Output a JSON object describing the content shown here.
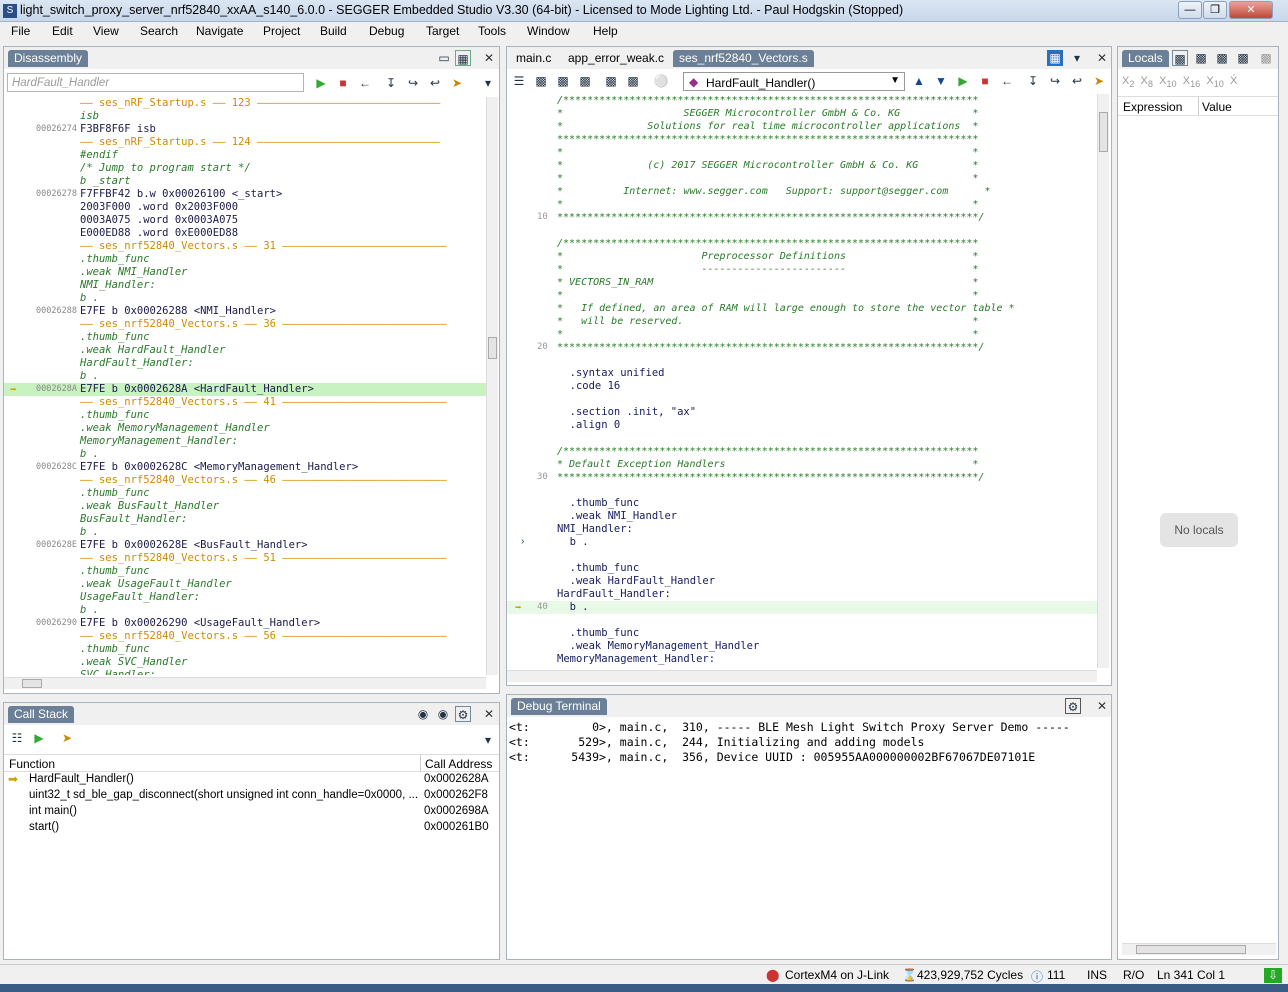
{
  "window": {
    "title": "light_switch_proxy_server_nrf52840_xxAA_s140_6.0.0 - SEGGER Embedded Studio V3.30 (64-bit) - Licensed to Mode Lighting Ltd. - Paul Hodgskin (Stopped)"
  },
  "menu": [
    "File",
    "Edit",
    "View",
    "Search",
    "Navigate",
    "Project",
    "Build",
    "Debug",
    "Target",
    "Tools",
    "Window",
    "Help"
  ],
  "disassembly": {
    "tab": "Disassembly",
    "search_placeholder": "HardFault_Handler",
    "lines": [
      {
        "t": "src",
        "text": "—— ses_nRF_Startup.s —— 123 —————————————————————————————"
      },
      {
        "t": "src-code",
        "text": "isb"
      },
      {
        "t": "ins",
        "addr": "00026274",
        "text": "    F3BF8F6F    isb"
      },
      {
        "t": "src",
        "text": "—— ses_nRF_Startup.s —— 124 —————————————————————————————"
      },
      {
        "t": "src-code",
        "text": "#endif"
      },
      {
        "t": "src-code",
        "text": "/* Jump to program start */"
      },
      {
        "t": "src-code",
        "text": "b _start"
      },
      {
        "t": "ins",
        "addr": "00026278",
        "text": "    F7FFBF42    b.w 0x00026100 <_start>"
      },
      {
        "t": "ins",
        "addr": "",
        "text": "    2003F000    .word 0x2003F000"
      },
      {
        "t": "ins",
        "addr": "",
        "text": "    0003A075    .word 0x0003A075"
      },
      {
        "t": "ins",
        "addr": "",
        "text": "    E000ED88    .word 0xE000ED88"
      },
      {
        "t": "src",
        "text": "—— ses_nrf52840_Vectors.s —— 31 ——————————————————————————"
      },
      {
        "t": "src-code",
        "text": ".thumb_func"
      },
      {
        "t": "src-code",
        "text": ".weak NMI_Handler"
      },
      {
        "t": "src-code",
        "text": "NMI_Handler:"
      },
      {
        "t": "src-code",
        "text": "b ."
      },
      {
        "t": "ins",
        "addr": "00026288",
        "text": "      E7FE        b 0x00026288 <NMI_Handler>"
      },
      {
        "t": "src",
        "text": "—— ses_nrf52840_Vectors.s —— 36 ——————————————————————————"
      },
      {
        "t": "src-code",
        "text": ".thumb_func"
      },
      {
        "t": "src-code",
        "text": ".weak HardFault_Handler"
      },
      {
        "t": "src-code",
        "text": "HardFault_Handler:"
      },
      {
        "t": "src-code",
        "text": "b ."
      },
      {
        "t": "cur",
        "addr": "0002628A",
        "text": "      E7FE        b 0x0002628A <HardFault_Handler>"
      },
      {
        "t": "src",
        "text": "—— ses_nrf52840_Vectors.s —— 41 ——————————————————————————"
      },
      {
        "t": "src-code",
        "text": ".thumb_func"
      },
      {
        "t": "src-code",
        "text": ".weak MemoryManagement_Handler"
      },
      {
        "t": "src-code",
        "text": "MemoryManagement_Handler:"
      },
      {
        "t": "src-code",
        "text": "b ."
      },
      {
        "t": "ins",
        "addr": "0002628C",
        "text": "      E7FE        b 0x0002628C <MemoryManagement_Handler>"
      },
      {
        "t": "src",
        "text": "—— ses_nrf52840_Vectors.s —— 46 ——————————————————————————"
      },
      {
        "t": "src-code",
        "text": ".thumb_func"
      },
      {
        "t": "src-code",
        "text": ".weak BusFault_Handler"
      },
      {
        "t": "src-code",
        "text": "BusFault_Handler:"
      },
      {
        "t": "src-code",
        "text": "b ."
      },
      {
        "t": "ins",
        "addr": "0002628E",
        "text": "      E7FE        b 0x0002628E <BusFault_Handler>"
      },
      {
        "t": "src",
        "text": "—— ses_nrf52840_Vectors.s —— 51 ——————————————————————————"
      },
      {
        "t": "src-code",
        "text": ".thumb_func"
      },
      {
        "t": "src-code",
        "text": ".weak UsageFault_Handler"
      },
      {
        "t": "src-code",
        "text": "UsageFault_Handler:"
      },
      {
        "t": "src-code",
        "text": "b ."
      },
      {
        "t": "ins",
        "addr": "00026290",
        "text": "      E7FE        b 0x00026290 <UsageFault_Handler>"
      },
      {
        "t": "src",
        "text": "—— ses_nrf52840_Vectors.s —— 56 ——————————————————————————"
      },
      {
        "t": "src-code",
        "text": ".thumb_func"
      },
      {
        "t": "src-code",
        "text": ".weak SVC_Handler"
      },
      {
        "t": "src-code",
        "text": "SVC_Handler:"
      }
    ]
  },
  "editor": {
    "tabs": [
      "main.c",
      "app_error_weak.c",
      "ses_nrf52840_Vectors.s"
    ],
    "function_select": "HardFault_Handler()",
    "lines": [
      {
        "n": "",
        "c": "cmt",
        "text": "/*********************************************************************"
      },
      {
        "n": "",
        "c": "cmt",
        "text": "*                    SEGGER Microcontroller GmbH & Co. KG            *"
      },
      {
        "n": "",
        "c": "cmt",
        "text": "*              Solutions for real time microcontroller applications  *"
      },
      {
        "n": "",
        "c": "cmt",
        "text": "**********************************************************************"
      },
      {
        "n": "",
        "c": "cmt",
        "text": "*                                                                    *"
      },
      {
        "n": "",
        "c": "cmt",
        "text": "*              (c) 2017 SEGGER Microcontroller GmbH & Co. KG         *"
      },
      {
        "n": "",
        "c": "cmt",
        "text": "*                                                                    *"
      },
      {
        "n": "",
        "c": "cmt",
        "text": "*          Internet: www.segger.com   Support: support@segger.com      *"
      },
      {
        "n": "",
        "c": "cmt",
        "text": "*                                                                    *"
      },
      {
        "n": "10",
        "c": "cmt",
        "text": "**********************************************************************/"
      },
      {
        "n": "",
        "c": "",
        "text": ""
      },
      {
        "n": "",
        "c": "cmt",
        "text": "/*********************************************************************"
      },
      {
        "n": "",
        "c": "cmt",
        "text": "*                       Preprocessor Definitions                     *"
      },
      {
        "n": "",
        "c": "cmt",
        "text": "*                       ------------------------                     *"
      },
      {
        "n": "",
        "c": "cmt",
        "text": "* VECTORS_IN_RAM                                                     *"
      },
      {
        "n": "",
        "c": "cmt",
        "text": "*                                                                    *"
      },
      {
        "n": "",
        "c": "cmt",
        "text": "*   If defined, an area of RAM will large enough to store the vector table *"
      },
      {
        "n": "",
        "c": "cmt",
        "text": "*   will be reserved.                                                *"
      },
      {
        "n": "",
        "c": "cmt",
        "text": "*                                                                    *"
      },
      {
        "n": "20",
        "c": "cmt",
        "text": "**********************************************************************/"
      },
      {
        "n": "",
        "c": "",
        "text": ""
      },
      {
        "n": "",
        "c": "code",
        "text": "  .syntax unified"
      },
      {
        "n": "",
        "c": "code",
        "text": "  .code 16"
      },
      {
        "n": "",
        "c": "",
        "text": ""
      },
      {
        "n": "",
        "c": "code",
        "text": "  .section .init, \"ax\""
      },
      {
        "n": "",
        "c": "code",
        "text": "  .align 0"
      },
      {
        "n": "",
        "c": "",
        "text": ""
      },
      {
        "n": "",
        "c": "cmt",
        "text": "/*********************************************************************"
      },
      {
        "n": "",
        "c": "cmt",
        "text": "* Default Exception Handlers                                         *"
      },
      {
        "n": "30",
        "c": "cmt",
        "text": "**********************************************************************/"
      },
      {
        "n": "",
        "c": "",
        "text": ""
      },
      {
        "n": "",
        "c": "code",
        "text": "  .thumb_func"
      },
      {
        "n": "",
        "c": "code",
        "text": "  .weak NMI_Handler"
      },
      {
        "n": "",
        "c": "code",
        "text": "NMI_Handler:"
      },
      {
        "n": "",
        "c": "code",
        "text": "  b ."
      },
      {
        "n": "",
        "c": "",
        "text": ""
      },
      {
        "n": "",
        "c": "code",
        "text": "  .thumb_func"
      },
      {
        "n": "",
        "c": "code",
        "text": "  .weak HardFault_Handler"
      },
      {
        "n": "",
        "c": "code",
        "text": "HardFault_Handler:"
      },
      {
        "n": "40",
        "c": "cur",
        "text": "  b ."
      },
      {
        "n": "",
        "c": "",
        "text": ""
      },
      {
        "n": "",
        "c": "code",
        "text": "  .thumb_func"
      },
      {
        "n": "",
        "c": "code",
        "text": "  .weak MemoryManagement_Handler"
      },
      {
        "n": "",
        "c": "code",
        "text": "MemoryManagement_Handler:"
      }
    ]
  },
  "locals": {
    "tab": "Locals",
    "col_expression": "Expression",
    "col_value": "Value",
    "empty": "No locals"
  },
  "callstack": {
    "tab": "Call Stack",
    "col_function": "Function",
    "col_address": "Call Address",
    "rows": [
      {
        "fn": "HardFault_Handler()",
        "addr": "0x0002628A"
      },
      {
        "fn": "uint32_t sd_ble_gap_disconnect(short unsigned int conn_handle=0x0000, ...",
        "addr": "0x000262F8"
      },
      {
        "fn": "int main()",
        "addr": "0x0002698A"
      },
      {
        "fn": "start()",
        "addr": "0x000261B0"
      }
    ]
  },
  "terminal": {
    "tab": "Debug Terminal",
    "lines": [
      "<t:         0>, main.c,  310, ----- BLE Mesh Light Switch Proxy Server Demo -----",
      "<t:       529>, main.c,  244, Initializing and adding models",
      "<t:      5439>, main.c,  356, Device UUID : 005955AA000000002BF67067DE07101E"
    ]
  },
  "status": {
    "target": "CortexM4 on J-Link",
    "cycles": "423,929,752 Cycles",
    "count": "111",
    "ins": "INS",
    "ro": "R/O",
    "pos": "Ln 341 Col 1"
  }
}
